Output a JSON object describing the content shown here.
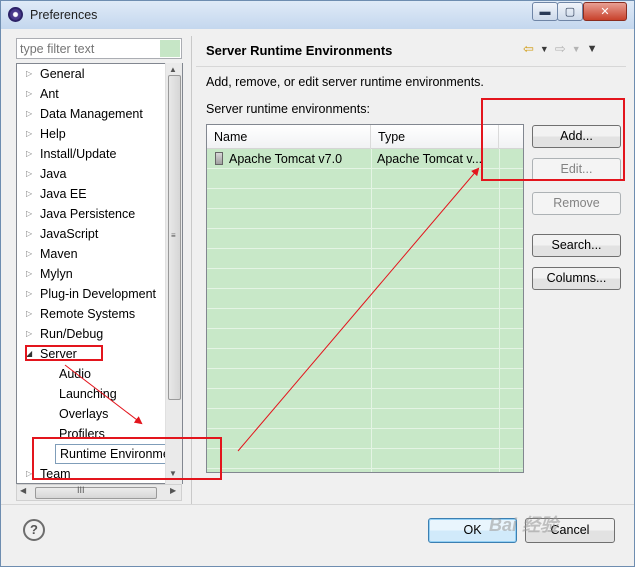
{
  "window": {
    "title": "Preferences",
    "min_glyph": "▬",
    "max_glyph": "▢",
    "close_glyph": "✕"
  },
  "filter": {
    "placeholder": "type filter text"
  },
  "tree": {
    "items": [
      {
        "label": "General",
        "expanded": false
      },
      {
        "label": "Ant",
        "expanded": false
      },
      {
        "label": "Data Management",
        "expanded": false
      },
      {
        "label": "Help",
        "expanded": false
      },
      {
        "label": "Install/Update",
        "expanded": false
      },
      {
        "label": "Java",
        "expanded": false
      },
      {
        "label": "Java EE",
        "expanded": false
      },
      {
        "label": "Java Persistence",
        "expanded": false
      },
      {
        "label": "JavaScript",
        "expanded": false
      },
      {
        "label": "Maven",
        "expanded": false
      },
      {
        "label": "Mylyn",
        "expanded": false
      },
      {
        "label": "Plug-in Development",
        "expanded": false
      },
      {
        "label": "Remote Systems",
        "expanded": false
      },
      {
        "label": "Run/Debug",
        "expanded": false
      },
      {
        "label": "Server",
        "expanded": true
      },
      {
        "label": "Audio",
        "child": true
      },
      {
        "label": "Launching",
        "child": true
      },
      {
        "label": "Overlays",
        "child": true
      },
      {
        "label": "Profilers",
        "child": true
      },
      {
        "label": "Runtime Environments",
        "child": true,
        "selected": true
      },
      {
        "label": "Team",
        "expanded": false
      }
    ],
    "scroll_grip": "≡",
    "hscroll_grip": "III"
  },
  "page": {
    "title": "Server Runtime Environments",
    "description": "Add, remove, or edit server runtime environments.",
    "list_label": "Server runtime environments:",
    "nav": {
      "back_glyph": "⇦",
      "forward_glyph": "⇨",
      "menu_glyph": "▼",
      "dropdown_glyph": "▼"
    }
  },
  "table": {
    "columns": [
      "Name",
      "Type"
    ],
    "rows": [
      {
        "name": "Apache Tomcat v7.0",
        "type": "Apache Tomcat v..."
      }
    ]
  },
  "buttons": {
    "add": "Add...",
    "edit": "Edit...",
    "remove": "Remove",
    "search": "Search...",
    "columns": "Columns..."
  },
  "footer": {
    "help": "?",
    "ok": "OK",
    "cancel": "Cancel",
    "watermark": "Bai 经验"
  },
  "annotation_color": "#e3151d"
}
